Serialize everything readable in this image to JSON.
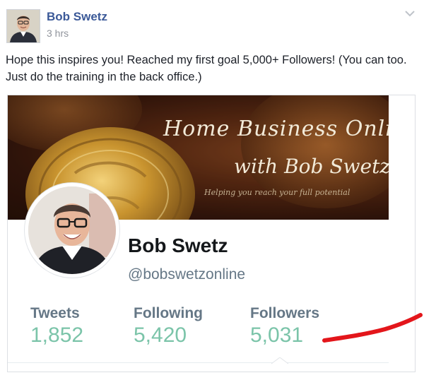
{
  "post": {
    "author": "Bob Swetz",
    "time": "3 hrs",
    "text": "Hope this inspires you! Reached my first goal 5,000+ Followers! (You can too. Just do the training in the back office.)"
  },
  "card": {
    "banner": {
      "title": "Home Business Online",
      "subtitle": "with Bob Swetz",
      "tagline": "Helping you reach your full potential"
    },
    "profile": {
      "name": "Bob Swetz",
      "handle": "@bobswetzonline"
    },
    "stats": [
      {
        "label": "Tweets",
        "value": "1,852"
      },
      {
        "label": "Following",
        "value": "5,420"
      },
      {
        "label": "Followers",
        "value": "5,031"
      }
    ]
  },
  "colors": {
    "author_link": "#3b5998",
    "stat_value": "#7bc4a9",
    "annotation": "#e3161b"
  },
  "icons": {
    "post_menu": "chevron-down-icon"
  }
}
